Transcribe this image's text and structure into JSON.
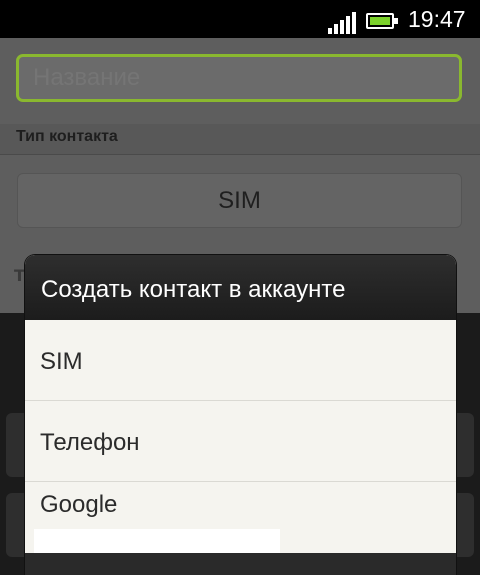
{
  "status_bar": {
    "time": "19:47",
    "signal_icon": "signal-bars-icon",
    "battery_icon": "battery-icon"
  },
  "form": {
    "name_placeholder": "Название",
    "section_header": "Тип контакта",
    "contact_type_value": "SIM",
    "partial_label": "Т"
  },
  "dialog": {
    "title": "Создать контакт в аккаунте",
    "options": [
      {
        "label": "SIM"
      },
      {
        "label": "Телефон"
      },
      {
        "label": "Google"
      }
    ]
  },
  "colors": {
    "accent_focus": "#8ab82f",
    "battery_fill": "#7bd12a",
    "dialog_bg": "#f5f4ef"
  }
}
